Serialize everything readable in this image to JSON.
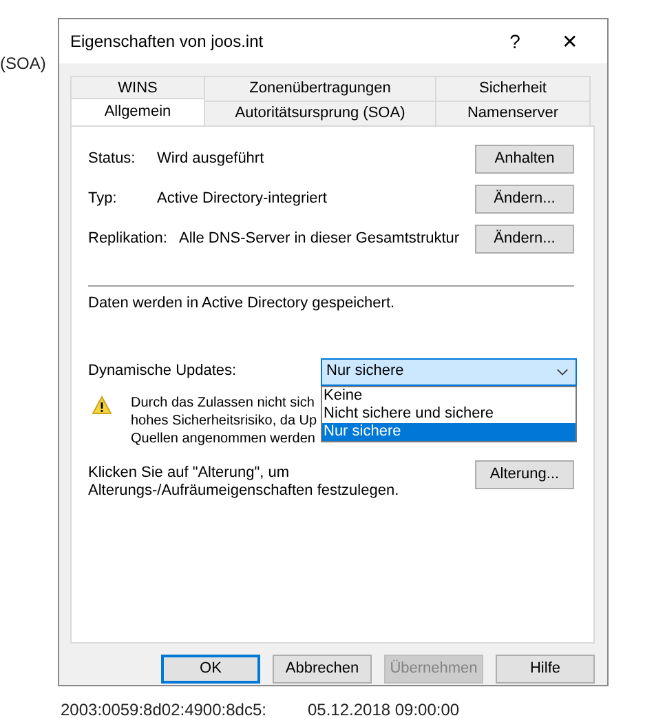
{
  "background": {
    "left_text": "(SOA)",
    "bottom_row": [
      "2003:0059:8d02:4900:8dc5:",
      "05.12.2018 09:00:00"
    ]
  },
  "window": {
    "title": "Eigenschaften von joos.int",
    "help": "?",
    "close": "✕"
  },
  "tabs": [
    [
      {
        "label": "WINS",
        "selected": false
      },
      {
        "label": "Zonenübertragungen",
        "selected": false
      },
      {
        "label": "Sicherheit",
        "selected": false
      }
    ],
    [
      {
        "label": "Allgemein",
        "selected": true
      },
      {
        "label": "Autoritätsursprung (SOA)",
        "selected": false
      },
      {
        "label": "Namenserver",
        "selected": false
      }
    ]
  ],
  "info_rows": [
    {
      "label": "Status:",
      "value": "Wird ausgeführt",
      "button": "Anhalten"
    },
    {
      "label": "Typ:",
      "value": "Active Directory-integriert",
      "button": "Ändern..."
    },
    {
      "label": "Replikation:",
      "value": "Alle DNS-Server in dieser Gesamtstruktur",
      "button": "Ändern..."
    }
  ],
  "storage_note": "Daten werden in Active Directory gespeichert.",
  "dynamic_updates": {
    "label": "Dynamische Updates:",
    "value": "Nur sichere",
    "expanded": true,
    "options": [
      {
        "label": "Keine",
        "selected": false
      },
      {
        "label": "Nicht sichere und sichere",
        "selected": false
      },
      {
        "label": "Nur sichere",
        "selected": true
      }
    ]
  },
  "warning_lines": [
    "Durch das Zulassen nicht sich",
    "hohes Sicherheitsrisiko, da Up",
    "Quellen angenommen werden"
  ],
  "aging": {
    "text_lines": [
      "Klicken Sie auf \"Alterung\", um",
      "Alterungs-/Aufräumeigenschaften festzulegen."
    ],
    "button": "Alterung..."
  },
  "buttons": [
    {
      "label": "OK",
      "default": true,
      "disabled": false
    },
    {
      "label": "Abbrechen",
      "default": false,
      "disabled": false
    },
    {
      "label": "Übernehmen",
      "default": false,
      "disabled": true
    },
    {
      "label": "Hilfe",
      "default": false,
      "disabled": false
    }
  ]
}
